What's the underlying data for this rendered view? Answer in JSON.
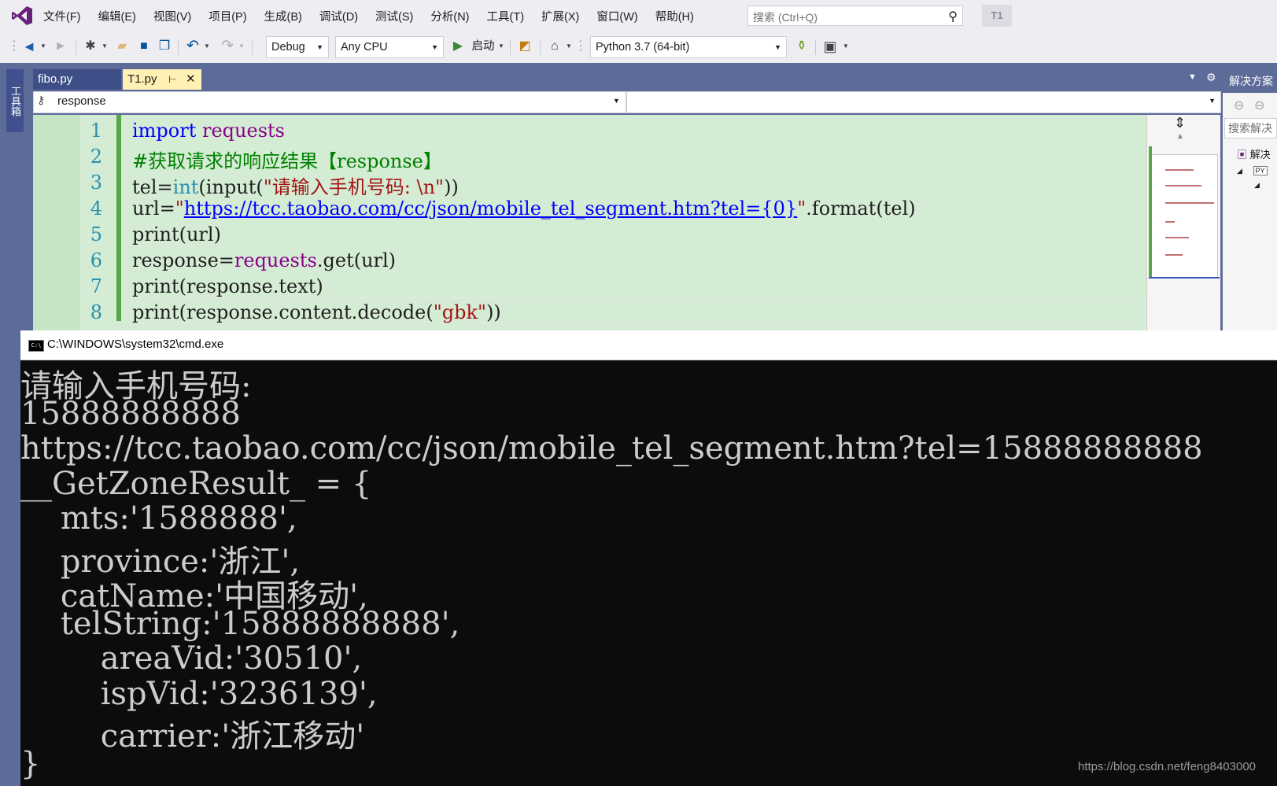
{
  "menu": {
    "items": [
      "文件(F)",
      "编辑(E)",
      "视图(V)",
      "项目(P)",
      "生成(B)",
      "调试(D)",
      "测试(S)",
      "分析(N)",
      "工具(T)",
      "扩展(X)",
      "窗口(W)",
      "帮助(H)"
    ],
    "search_placeholder": "搜索 (Ctrl+Q)",
    "project_badge": "T1"
  },
  "toolbar": {
    "config": "Debug",
    "platform": "Any CPU",
    "start_label": "启动",
    "environment": "Python 3.7 (64-bit)"
  },
  "toolbox": {
    "label": "工具箱"
  },
  "tabs": [
    {
      "label": "fibo.py",
      "active": false
    },
    {
      "label": "T1.py",
      "active": true,
      "pin": "⊢",
      "close": "✕"
    }
  ],
  "navbar": {
    "member": "response"
  },
  "editor": {
    "line_numbers": [
      "1",
      "2",
      "3",
      "4",
      "5",
      "6",
      "7",
      "8"
    ],
    "lines": [
      [
        {
          "t": "import",
          "c": "kw"
        },
        {
          "t": " requests",
          "c": "mod"
        }
      ],
      [
        {
          "t": "#获取请求的响应结果【response】",
          "c": "cm"
        }
      ],
      [
        {
          "t": "tel=",
          "c": "fn"
        },
        {
          "t": "int",
          "c": "ty"
        },
        {
          "t": "(input(",
          "c": "fn"
        },
        {
          "t": "\"请输入手机号码: \\n\"",
          "c": "st"
        },
        {
          "t": "))",
          "c": "fn"
        }
      ],
      [
        {
          "t": "url=",
          "c": "fn"
        },
        {
          "t": "\"",
          "c": "st"
        },
        {
          "t": "https://tcc.taobao.com/cc/json/mobile_tel_segment.htm?tel={0}",
          "c": "url"
        },
        {
          "t": "\"",
          "c": "st"
        },
        {
          "t": ".format(tel)",
          "c": "fn"
        }
      ],
      [
        {
          "t": "print(url)",
          "c": "fn"
        }
      ],
      [
        {
          "t": "response=",
          "c": "fn"
        },
        {
          "t": "requests",
          "c": "mod"
        },
        {
          "t": ".get(url)",
          "c": "fn"
        }
      ],
      [
        {
          "t": "print(response.text)",
          "c": "fn"
        }
      ],
      [
        {
          "t": "print(response.content.decode(",
          "c": "fn"
        },
        {
          "t": "\"gbk\"",
          "c": "st"
        },
        {
          "t": "))",
          "c": "fn"
        }
      ]
    ]
  },
  "solution": {
    "header": "解决方案",
    "search": "搜索解决",
    "root": "解决",
    "py_badge": "PY"
  },
  "cmd": {
    "title": "C:\\WINDOWS\\system32\\cmd.exe",
    "icon_text": "C:\\",
    "lines": [
      "请输入手机号码:",
      "15888888888",
      "https://tcc.taobao.com/cc/json/mobile_tel_segment.htm?tel=15888888888",
      "__GetZoneResult_ = {",
      "    mts:'1588888',",
      "    province:'浙江',",
      "    catName:'中国移动',",
      "    telString:'15888888888',",
      "        areaVid:'30510',",
      "        ispVid:'3236139',",
      "        carrier:'浙江移动'",
      "}"
    ]
  },
  "watermark": "https://blog.csdn.net/feng8403000",
  "colors": {
    "frame": "#5d6b99",
    "editor_bg": "#d4ecd4",
    "active_tab": "#fff0b3",
    "console_bg": "#0c0c0c"
  }
}
